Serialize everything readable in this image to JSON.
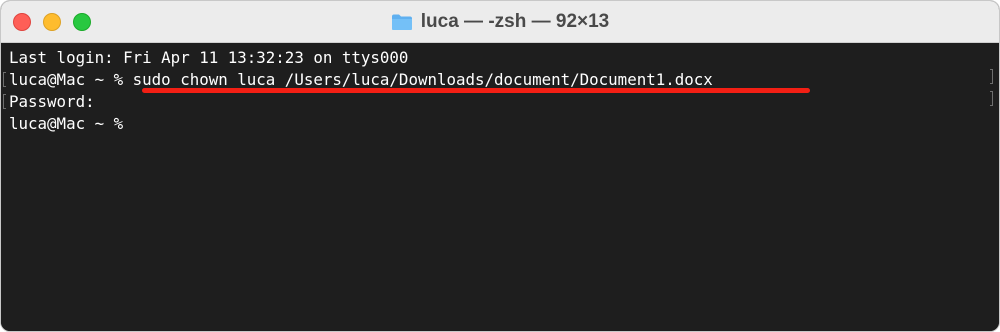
{
  "window": {
    "title": "luca — -zsh — 92×13"
  },
  "terminal": {
    "lines": [
      {
        "prompt": "",
        "text": "Last login: Fri Apr 11 13:32:23 on ttys000"
      },
      {
        "prompt": "luca@Mac ~ % ",
        "text": "sudo chown luca /Users/luca/Downloads/document/Document1.docx"
      },
      {
        "prompt": "",
        "text": "Password:"
      },
      {
        "prompt": "luca@Mac ~ % ",
        "text": ""
      }
    ]
  },
  "icons": {
    "title_icon": "folder-icon"
  },
  "colors": {
    "terminal_bg": "#1e1e1e",
    "text": "#ffffff",
    "highlight_underline": "#f21f14",
    "close": "#fe5f57",
    "minimize": "#febc2e",
    "maximize": "#28c840"
  }
}
